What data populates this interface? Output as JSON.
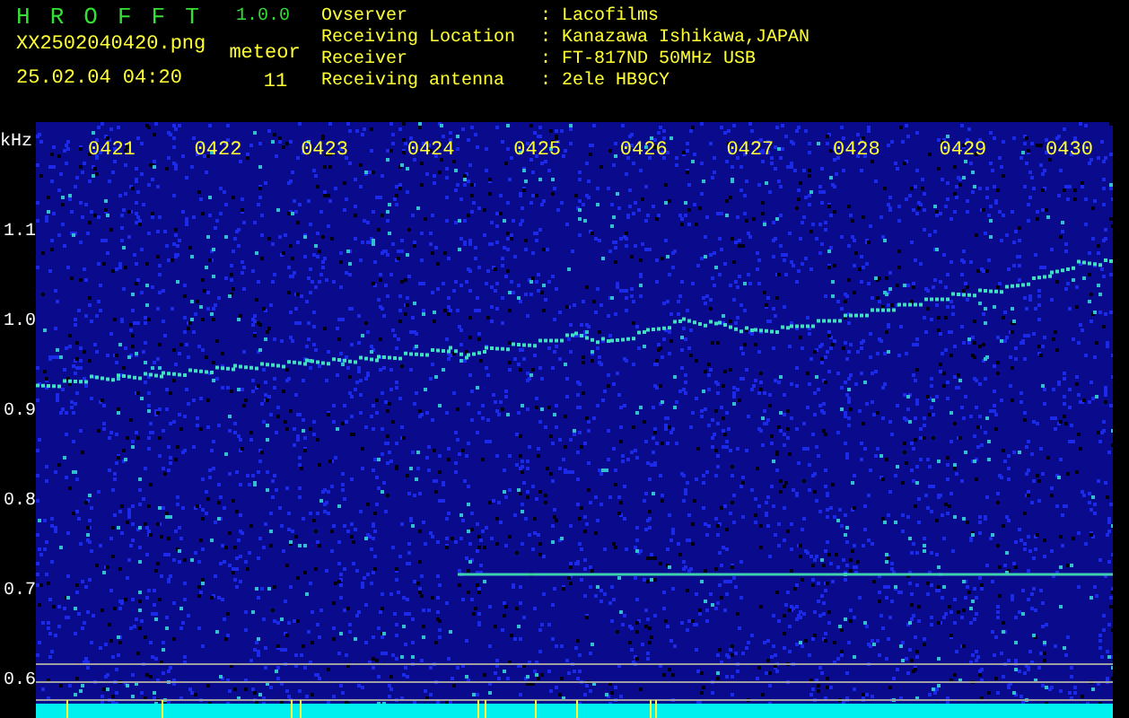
{
  "app": {
    "title_letters": [
      "H",
      "R",
      "O",
      "F",
      "F",
      "T"
    ],
    "version": "1.0.0",
    "filename": "XX2502040420.png",
    "datetime": "25.02.04 04:20",
    "count_label": "meteor",
    "count": "11"
  },
  "info": [
    {
      "label": "Ovserver",
      "sep": ":",
      "value": "Lacofilms"
    },
    {
      "label": "Receiving Location",
      "sep": ":",
      "value": "Kanazawa Ishikawa,JAPAN"
    },
    {
      "label": "Receiver",
      "sep": ":",
      "value": "FT-817ND 50MHz USB"
    },
    {
      "label": "Receiving antenna",
      "sep": ":",
      "value": "2ele HB9CY"
    }
  ],
  "spectrogram": {
    "unit": "kHz",
    "freq_labels": [
      "1.1",
      "1.0",
      "0.9",
      "0.8",
      "0.7",
      "0.6"
    ],
    "time_labels": [
      "0421",
      "0422",
      "0423",
      "0424",
      "0425",
      "0426",
      "0427",
      "0428",
      "0429",
      "0430"
    ]
  }
}
